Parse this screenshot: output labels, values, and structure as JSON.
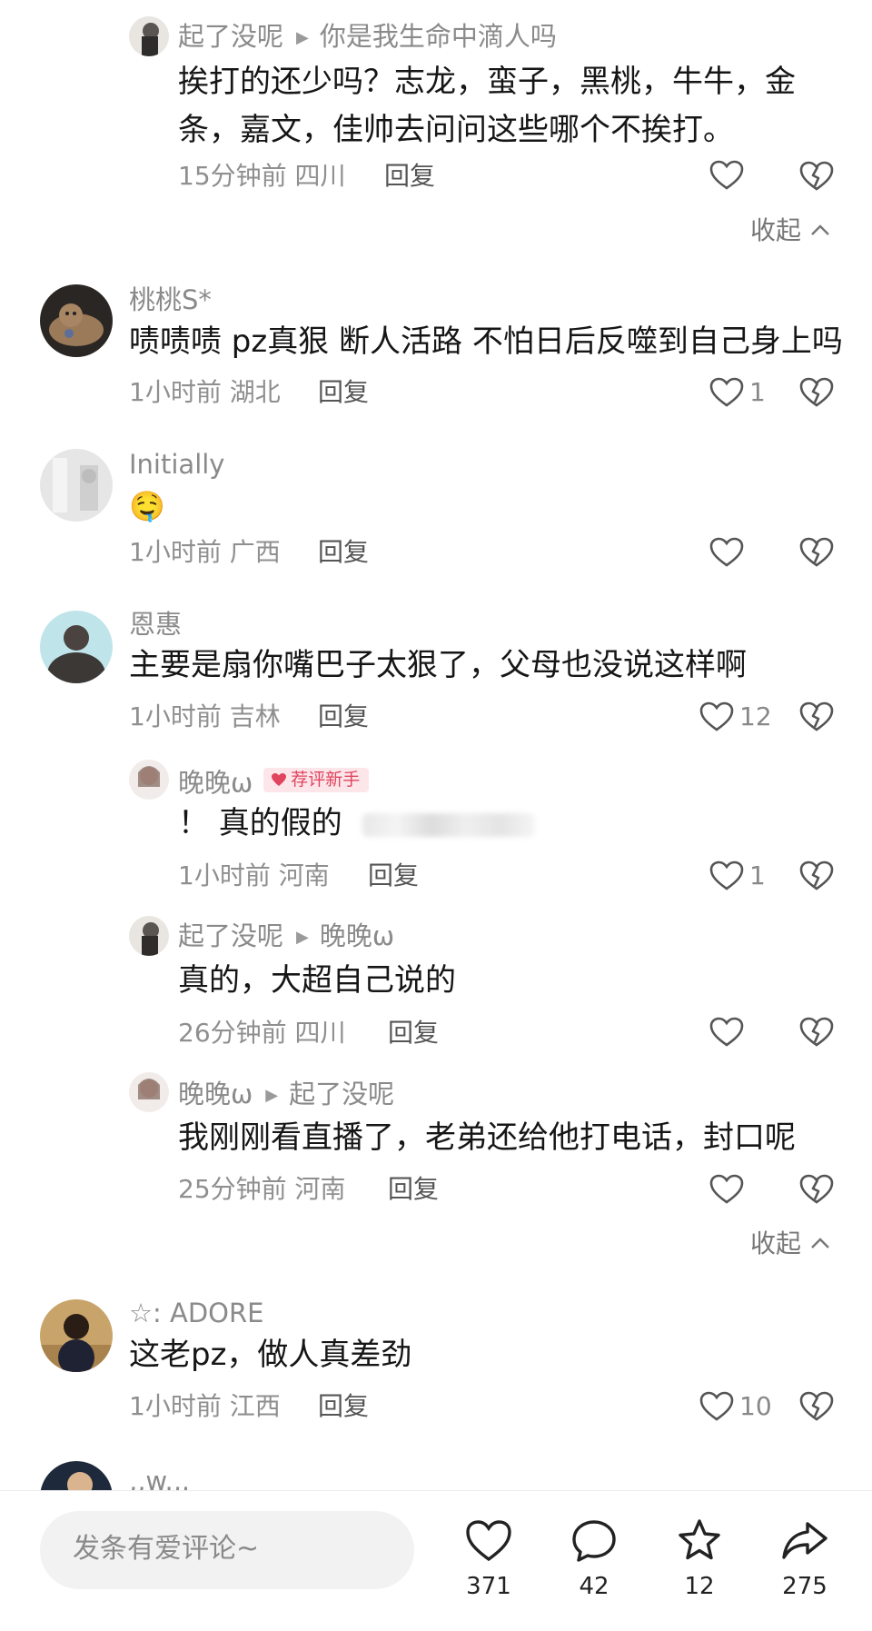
{
  "comments": [
    {
      "user": "起了没呢",
      "reply_to": "你是我生命中滴人吗",
      "text_line1": "挨打的还少吗？志龙，蛮子，黑桃，牛牛，金",
      "text_line2": "条，嘉文，佳帅去问问这些哪个不挨打。",
      "time": "15分钟前",
      "location": "四川",
      "reply_label": "回复",
      "likes": ""
    },
    {
      "user": "桃桃S*",
      "text": "啧啧啧 pz真狠 断人活路 不怕日后反噬到自己身上吗",
      "time": "1小时前",
      "location": "湖北",
      "reply_label": "回复",
      "likes": "1"
    },
    {
      "user": "Initially",
      "text": "🤤",
      "time": "1小时前",
      "location": "广西",
      "reply_label": "回复",
      "likes": ""
    },
    {
      "user": "恩惠",
      "text": "主要是扇你嘴巴子太狠了，父母也没说这样啊",
      "time": "1小时前",
      "location": "吉林",
      "reply_label": "回复",
      "likes": "12"
    },
    {
      "user": "晚晚ω",
      "badge": "荐评新手",
      "text": "！ 真的假的",
      "time": "1小时前",
      "location": "河南",
      "reply_label": "回复",
      "likes": "1"
    },
    {
      "user": "起了没呢",
      "reply_to": "晚晚ω",
      "text": "真的，大超自己说的",
      "time": "26分钟前",
      "location": "四川",
      "reply_label": "回复",
      "likes": ""
    },
    {
      "user": "晚晚ω",
      "reply_to": "起了没呢",
      "text": "我刚刚看直播了，老弟还给他打电话，封口呢",
      "time": "25分钟前",
      "location": "河南",
      "reply_label": "回复",
      "likes": ""
    },
    {
      "user": "☆: ADORE",
      "text": "这老pz，做人真差劲",
      "time": "1小时前",
      "location": "江西",
      "reply_label": "回复",
      "likes": "10"
    },
    {
      "user": ",,w.,."
    }
  ],
  "collapse_label": "收起",
  "bottom_bar": {
    "input_placeholder": "发条有爱评论~",
    "likes": "371",
    "comments": "42",
    "favorites": "12",
    "shares": "275"
  },
  "colors": {
    "badge_text": "#e0445e",
    "badge_bg": "#fde6ea",
    "meta_text": "#8f8f8f"
  }
}
